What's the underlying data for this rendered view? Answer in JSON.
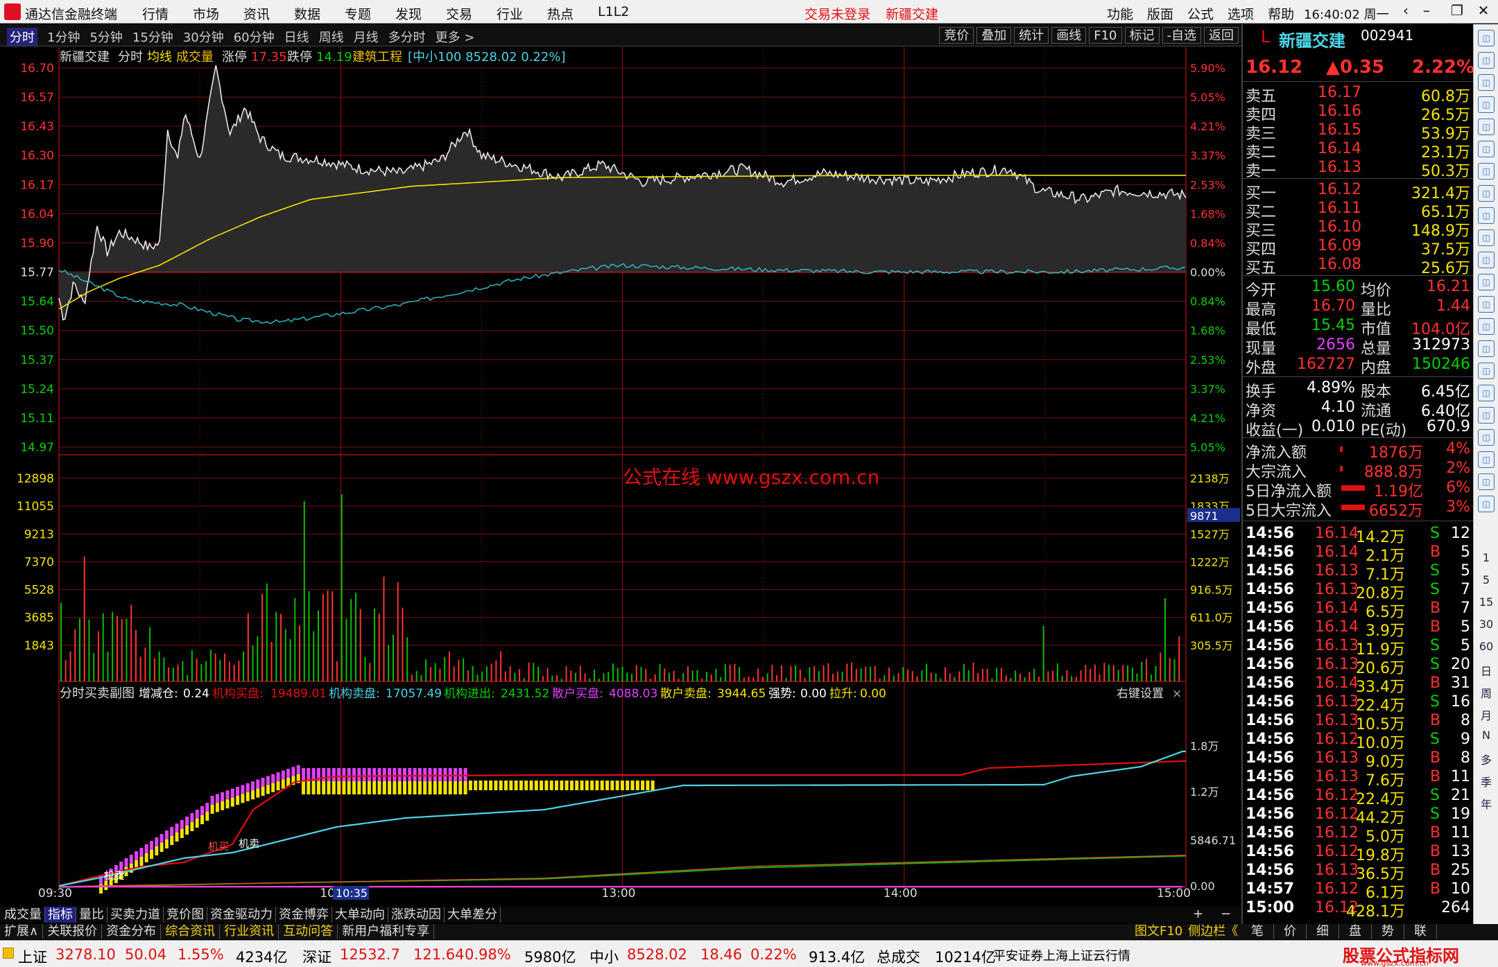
{
  "app": {
    "title": "通达信金融终端",
    "menu": [
      "行情",
      "市场",
      "资讯",
      "数据",
      "专题",
      "发现",
      "交易",
      "行业",
      "热点",
      "L1L2"
    ],
    "alert1": "交易未登录",
    "alert2": "新疆交建",
    "rmenu": [
      "功能",
      "版面",
      "公式",
      "选项",
      "帮助"
    ],
    "clock": "16:40:02",
    "weekday": "周一"
  },
  "period": {
    "tabs": [
      "分时",
      "1分钟",
      "5分钟",
      "15分钟",
      "30分钟",
      "60分钟",
      "日线",
      "周线",
      "月线",
      "多分时",
      "更多 >"
    ],
    "tools": [
      "竞价",
      "叠加",
      "统计",
      "画线",
      "F10",
      "标记",
      "-自选",
      "返回"
    ]
  },
  "main_header": {
    "stock": "新疆交建",
    "mode": "分时",
    "avg": "均线",
    "vol": "成交量",
    "zt_label": "涨停",
    "zt": "17.35",
    "dt_label": "跌停",
    "dt": "14.19",
    "sector": "建筑工程",
    "index": "[中小100 8528.02 0.22%]"
  },
  "watermark": "公式在线 www.gszx.com.cn",
  "price_axis": {
    "left": [
      "16.70",
      "16.57",
      "16.43",
      "16.30",
      "16.17",
      "16.04",
      "15.90",
      "15.77",
      "15.64",
      "15.50",
      "15.37",
      "15.24",
      "15.11",
      "14.97"
    ],
    "right": [
      "5.90%",
      "5.05%",
      "4.21%",
      "3.37%",
      "2.53%",
      "1.68%",
      "0.84%",
      "0.00%",
      "0.84%",
      "1.68%",
      "2.53%",
      "3.37%",
      "4.21%",
      "5.05%"
    ]
  },
  "vol_axis": {
    "left": [
      "12898",
      "11055",
      "9213",
      "7370",
      "5528",
      "3685",
      "1843"
    ],
    "right": [
      "2138万",
      "1833万",
      "1527万",
      "1222万",
      "916.5万",
      "611.0万",
      "305.5万"
    ],
    "cursor": "9871"
  },
  "sub_header": {
    "name": "分时买卖副图",
    "f1l": "增减仓:",
    "f1": "0.24",
    "f2l": "机构买盘:",
    "f2": "19489.01",
    "f3l": "机构卖盘:",
    "f3": "17057.49",
    "f4l": "机构进出:",
    "f4": "2431.52",
    "f5l": "散户买盘:",
    "f5": "4088.03",
    "f6l": "散户卖盘:",
    "f6": "3944.65",
    "f7l": "强势:",
    "f7": "0.00",
    "f8l": "拉升:",
    "f8": "0.00",
    "settings": "右键设置"
  },
  "sub_axis": [
    "1.8万",
    "1.2万",
    "5846.71",
    "0.00"
  ],
  "sub_labels": {
    "buy": "机买",
    "sell": "机卖"
  },
  "time_axis": [
    "09:30",
    "10:30",
    "13:00",
    "14:00",
    "15:00"
  ],
  "cursor_time": "10:35",
  "bottom_tabs": [
    "成交量",
    "指标",
    "量比",
    "买卖力道",
    "竞价图",
    "资金驱动力",
    "资金博弈",
    "大单动向",
    "涨跌动因",
    "大单差分"
  ],
  "tool_row": {
    "left": [
      "扩展∧",
      "关联报价",
      "资金分布",
      "综合资讯",
      "行业资讯",
      "互动问答",
      "新用户福利专享"
    ],
    "right": [
      "图文F10",
      "侧边栏《"
    ],
    "rtabs": [
      "笔",
      "价",
      "细",
      "盘",
      "势",
      "联"
    ]
  },
  "quote": {
    "name": "新疆交建",
    "code": "002941",
    "price": "16.12",
    "change": "▲0.35",
    "pct": "2.22%",
    "asks": [
      {
        "l": "卖五",
        "p": "16.17",
        "v": "60.8万"
      },
      {
        "l": "卖四",
        "p": "16.16",
        "v": "26.5万"
      },
      {
        "l": "卖三",
        "p": "16.15",
        "v": "53.9万"
      },
      {
        "l": "卖二",
        "p": "16.14",
        "v": "23.1万"
      },
      {
        "l": "卖一",
        "p": "16.13",
        "v": "50.3万"
      }
    ],
    "bids": [
      {
        "l": "买一",
        "p": "16.12",
        "v": "321.4万"
      },
      {
        "l": "买二",
        "p": "16.11",
        "v": "65.1万"
      },
      {
        "l": "买三",
        "p": "16.10",
        "v": "148.9万"
      },
      {
        "l": "买四",
        "p": "16.09",
        "v": "37.5万"
      },
      {
        "l": "买五",
        "p": "16.08",
        "v": "25.6万"
      }
    ],
    "stats": [
      [
        "今开",
        "15.60",
        "均价",
        "16.21"
      ],
      [
        "最高",
        "16.70",
        "量比",
        "1.44"
      ],
      [
        "最低",
        "15.45",
        "市值",
        "104.0亿"
      ],
      [
        "现量",
        "2656",
        "总量",
        "312973"
      ],
      [
        "外盘",
        "162727",
        "内盘",
        "150246"
      ]
    ],
    "stats2": [
      [
        "换手",
        "4.89%",
        "股本",
        "6.45亿"
      ],
      [
        "净资",
        "4.10",
        "流通",
        "6.40亿"
      ],
      [
        "收益(一)",
        "0.010",
        "PE(动)",
        "670.9"
      ]
    ],
    "flows": [
      [
        "净流入额",
        "1876万",
        "4%"
      ],
      [
        "大宗流入",
        "888.8万",
        "2%"
      ],
      [
        "5日净流入额",
        "1.19亿",
        "6%"
      ],
      [
        "5日大宗流入",
        "6652万",
        "3%"
      ]
    ],
    "ticks": [
      [
        "14:56",
        "16.14",
        "14.2万",
        "S",
        "12"
      ],
      [
        "14:56",
        "16.14",
        "2.1万",
        "B",
        "5"
      ],
      [
        "14:56",
        "16.13",
        "7.1万",
        "S",
        "5"
      ],
      [
        "14:56",
        "16.13",
        "20.8万",
        "S",
        "7"
      ],
      [
        "14:56",
        "16.14",
        "6.5万",
        "B",
        "7"
      ],
      [
        "14:56",
        "16.14",
        "3.9万",
        "B",
        "5"
      ],
      [
        "14:56",
        "16.13",
        "11.9万",
        "S",
        "5"
      ],
      [
        "14:56",
        "16.13",
        "20.6万",
        "S",
        "20"
      ],
      [
        "14:56",
        "16.14",
        "33.4万",
        "B",
        "31"
      ],
      [
        "14:56",
        "16.13",
        "22.4万",
        "S",
        "16"
      ],
      [
        "14:56",
        "16.13",
        "10.5万",
        "B",
        "8"
      ],
      [
        "14:56",
        "16.12",
        "10.0万",
        "S",
        "9"
      ],
      [
        "14:56",
        "16.13",
        "9.0万",
        "B",
        "8"
      ],
      [
        "14:56",
        "16.13",
        "7.6万",
        "B",
        "11"
      ],
      [
        "14:56",
        "16.12",
        "22.4万",
        "S",
        "21"
      ],
      [
        "14:56",
        "16.12",
        "44.2万",
        "S",
        "19"
      ],
      [
        "14:56",
        "16.12",
        "5.0万",
        "B",
        "11"
      ],
      [
        "14:56",
        "16.12",
        "19.8万",
        "B",
        "13"
      ],
      [
        "14:56",
        "16.13",
        "36.5万",
        "B",
        "25"
      ],
      [
        "14:57",
        "16.12",
        "6.1万",
        "B",
        "10"
      ],
      [
        "15:00",
        "16.12",
        "428.1万",
        "",
        "264"
      ]
    ]
  },
  "side_labels": [
    "1",
    "5",
    "15",
    "30",
    "60",
    "日",
    "周",
    "月",
    "N",
    "多",
    "季",
    "年"
  ],
  "status": {
    "sh_l": "上证",
    "sh": "3278.10",
    "sh_c": "50.04",
    "sh_p": "1.55%",
    "sh_a": "4234亿",
    "sz_l": "深证",
    "sz": "12532.7",
    "sz_c": "121.64",
    "sz_p": "0.98%",
    "sz_a": "5980亿",
    "zx_l": "中小",
    "zx": "8528.02",
    "zx_c": "18.46",
    "zx_p": "0.22%",
    "zx_a": "913.4亿",
    "tot_l": "总成交",
    "tot": "10214亿",
    "cloud": "平安证券上海上证云行情",
    "brand": "股票公式指标网",
    "brand_url": "www.gszx.com.cn"
  }
}
